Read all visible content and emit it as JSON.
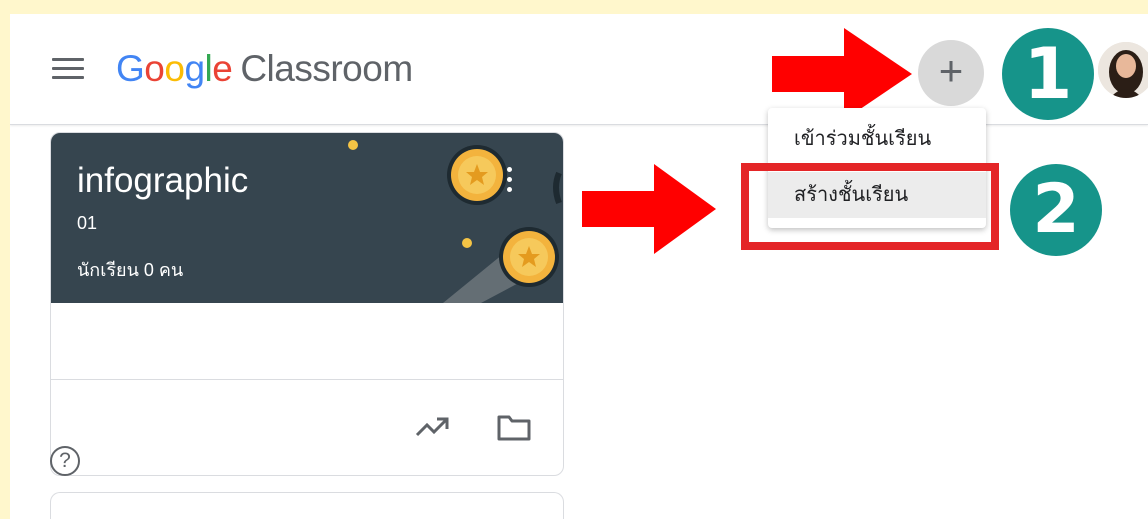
{
  "app": {
    "logo": {
      "g1": "G",
      "o1": "o",
      "o2": "o",
      "g2": "g",
      "l": "l",
      "e": "e",
      "suffix": "Classroom"
    }
  },
  "header": {
    "plus_label": "+"
  },
  "steps": {
    "step1": "1",
    "step2": "2"
  },
  "menu": {
    "items": [
      {
        "label": "เข้าร่วมชั้นเรียน"
      },
      {
        "label": "สร้างชั้นเรียน"
      }
    ]
  },
  "class_card": {
    "title": "infographic",
    "section": "01",
    "students": "นักเรียน 0 คน"
  },
  "help": {
    "label": "?"
  },
  "icons": {
    "menu": "hamburger-menu-icon",
    "trending": "trending-up-icon",
    "folder": "folder-icon",
    "help": "help-icon",
    "avatar": "user-avatar"
  },
  "colors": {
    "background": "#fff7cc",
    "accent_teal": "#16948a",
    "arrow_red": "#ff0000",
    "highlight_red": "#e42527",
    "card_header": "#36454f"
  }
}
